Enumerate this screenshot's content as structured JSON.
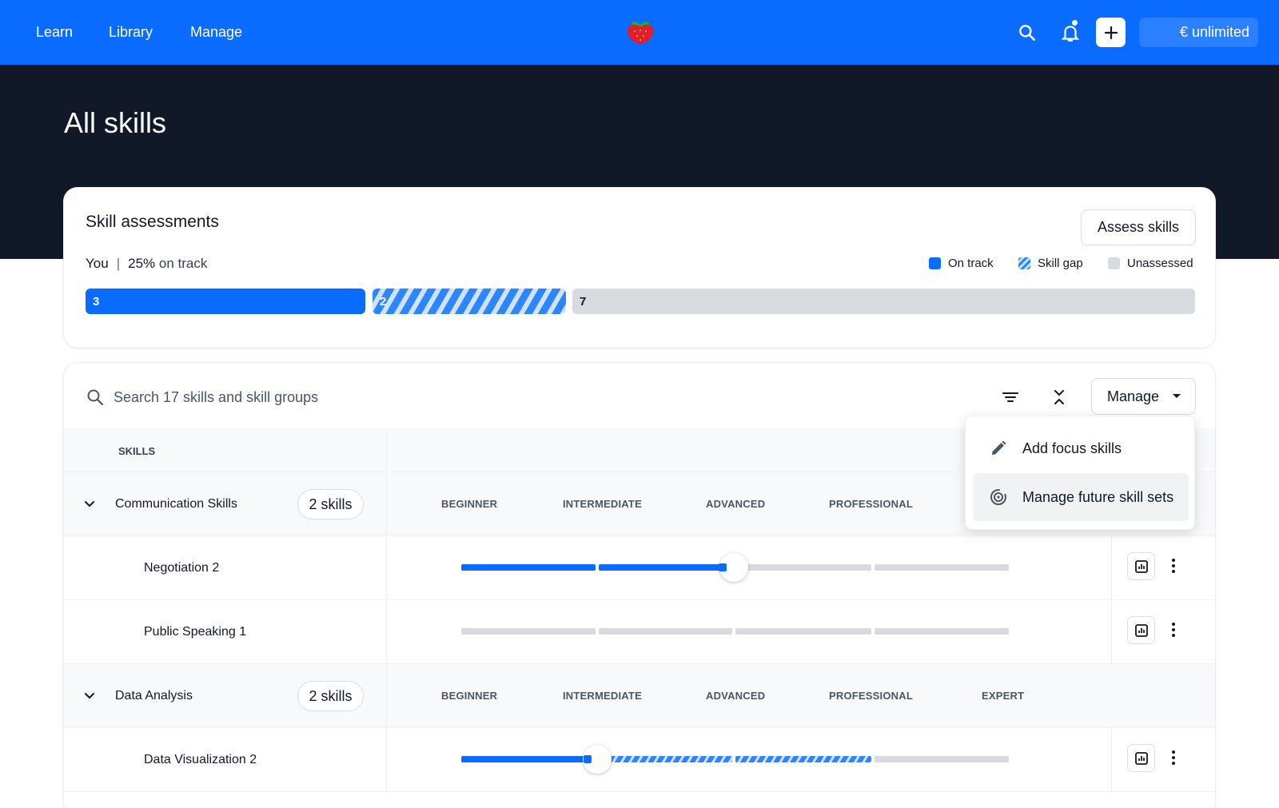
{
  "nav": {
    "links": [
      "Learn",
      "Library",
      "Manage"
    ],
    "unlimited_label": "€ unlimited"
  },
  "hero": {
    "title": "All skills"
  },
  "assessments": {
    "title": "Skill assessments",
    "assess_button": "Assess skills",
    "you_label": "You",
    "track_percent": "25%",
    "track_text": "on track",
    "legend": [
      "On track",
      "Skill gap",
      "Unassessed"
    ],
    "segments": {
      "on_track": "3",
      "skill_gap": "2",
      "unassessed": "7"
    }
  },
  "skills": {
    "search_placeholder": "Search 17 skills and skill groups",
    "manage_label": "Manage",
    "column_header": "SKILLS",
    "levels": [
      "BEGINNER",
      "INTERMEDIATE",
      "ADVANCED",
      "PROFESSIONAL",
      "EXPERT"
    ],
    "groups": [
      {
        "name": "Communication Skills",
        "count": "2 skills",
        "skills": [
          {
            "name": "Negotiation 2",
            "current_level": 2,
            "target_level": 2,
            "gap": false
          },
          {
            "name": "Public Speaking 1",
            "current_level": 0,
            "target_level": 0,
            "gap": false
          }
        ]
      },
      {
        "name": "Data Analysis",
        "count": "2 skills",
        "skills": [
          {
            "name": "Data Visualization 2",
            "current_level": 1,
            "target_level": 3,
            "gap": true
          }
        ]
      }
    ]
  },
  "menu": {
    "items": [
      "Add focus skills",
      "Manage future skill sets"
    ]
  },
  "colors": {
    "brand": "#0a6cff",
    "hero_bg": "#111827",
    "unassessed": "#d7dade"
  }
}
